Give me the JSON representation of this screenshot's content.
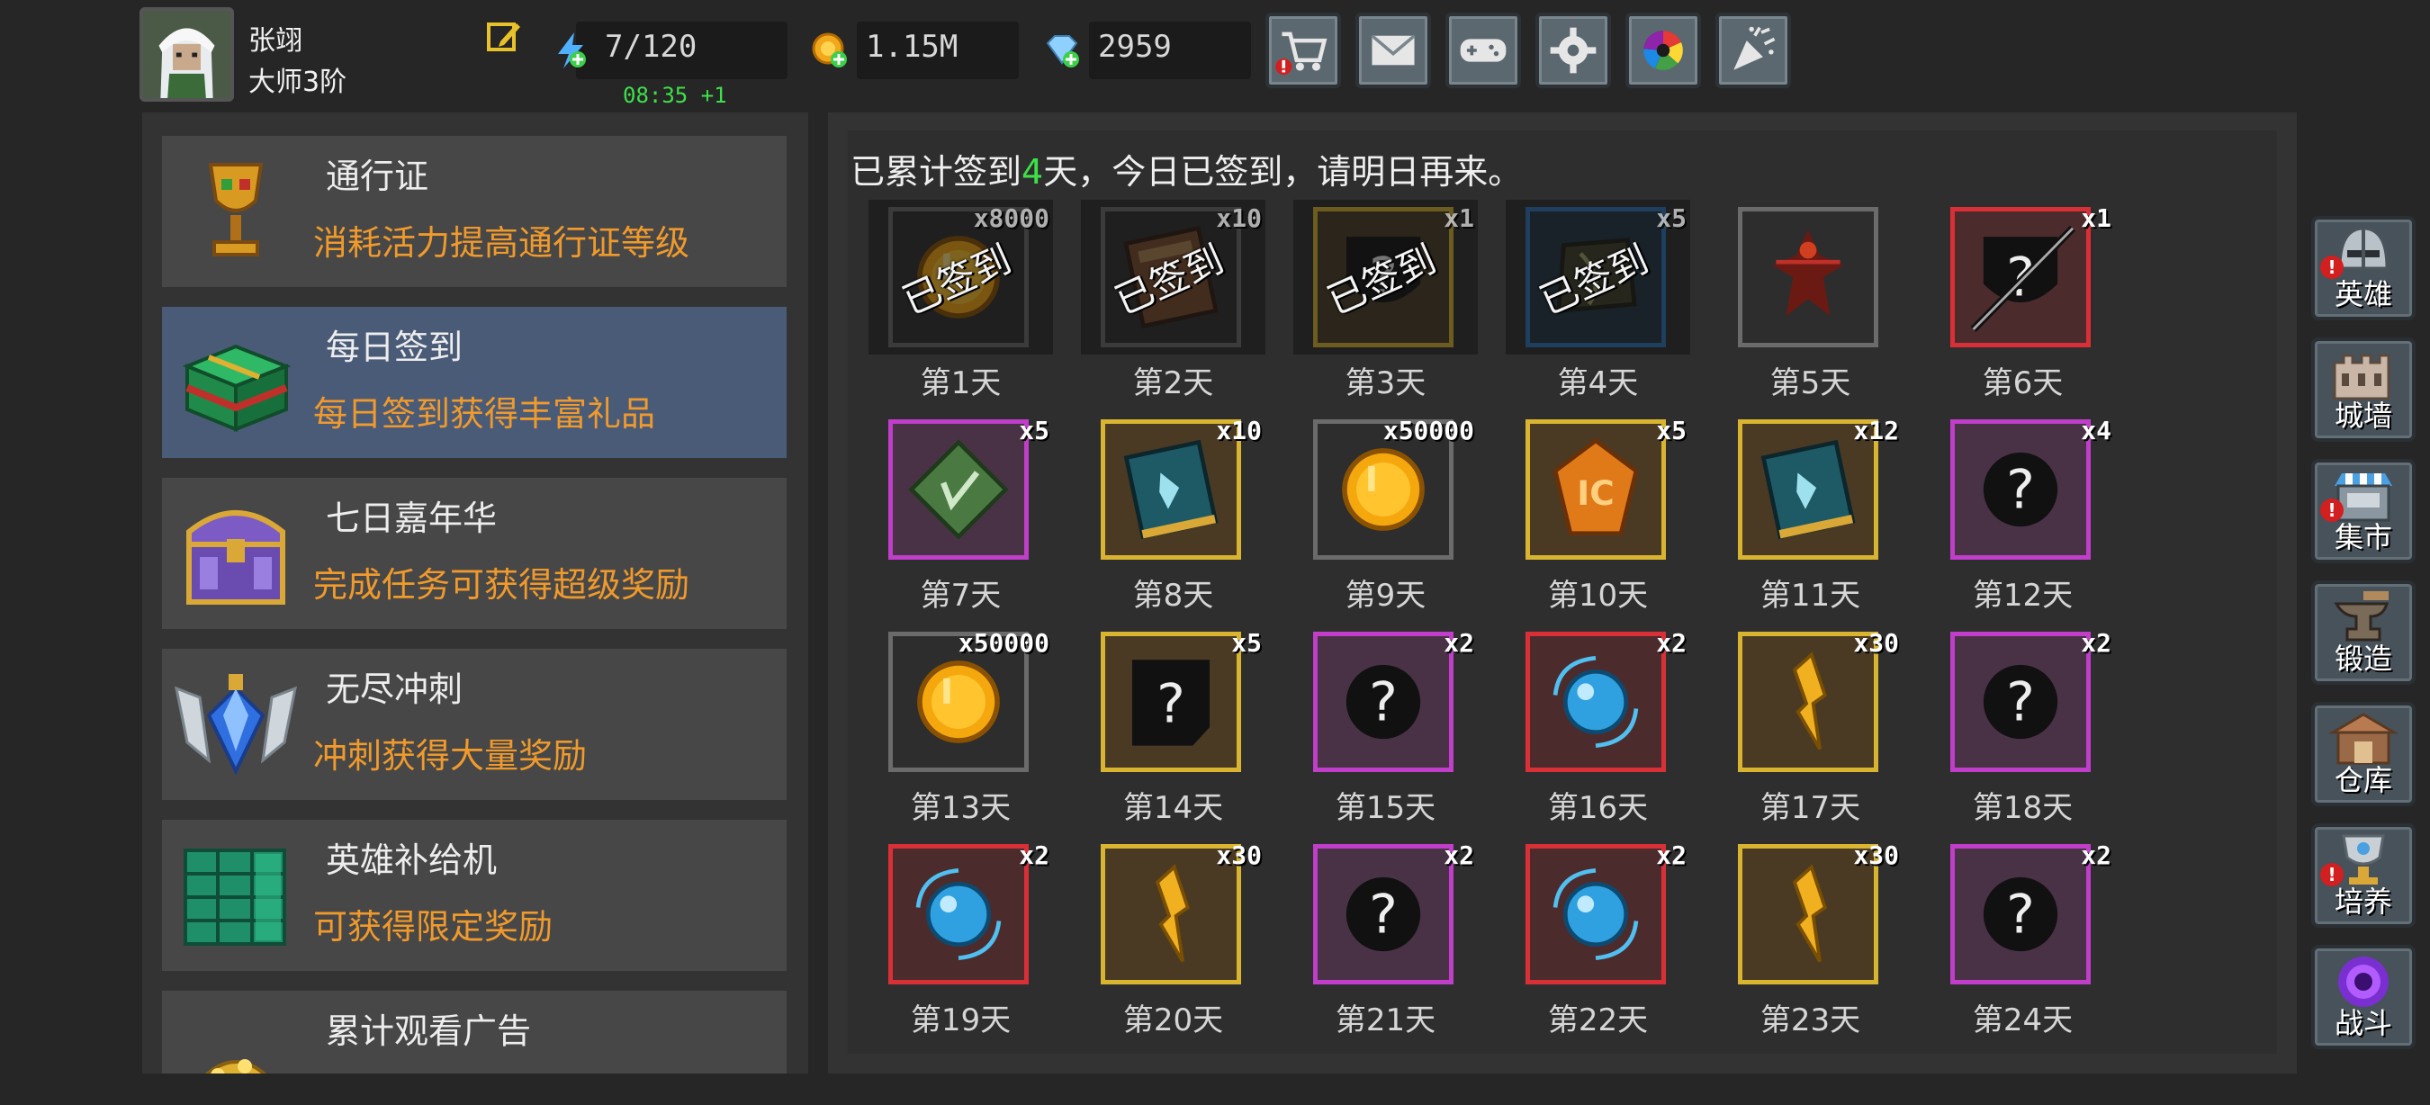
{
  "player": {
    "name": "张翊",
    "rank": "大师3阶"
  },
  "resources": {
    "energy": "7/120",
    "energy_timer": "08:35 +1",
    "gold": "1.15M",
    "gems": "2959"
  },
  "top_buttons": [
    {
      "name": "shop-button",
      "icon": "cart-icon",
      "alert": true
    },
    {
      "name": "mail-button",
      "icon": "envelope-icon",
      "alert": false
    },
    {
      "name": "gamepad-button",
      "icon": "gamepad-icon",
      "alert": false
    },
    {
      "name": "settings-button",
      "icon": "gear-icon",
      "alert": false
    },
    {
      "name": "aperture-button",
      "icon": "aperture-icon",
      "alert": false
    },
    {
      "name": "celebrate-button",
      "icon": "party-popper-icon",
      "alert": false
    }
  ],
  "activities": [
    {
      "title": "通行证",
      "desc": "消耗活力提高通行证等级",
      "icon": "chalice-icon",
      "selected": false
    },
    {
      "title": "每日签到",
      "desc": "每日签到获得丰富礼品",
      "icon": "gift-chest-icon",
      "selected": true
    },
    {
      "title": "七日嘉年华",
      "desc": "完成任务可获得超级奖励",
      "icon": "treasure-chest-icon",
      "selected": false
    },
    {
      "title": "无尽冲刺",
      "desc": "冲刺获得大量奖励",
      "icon": "winged-crystal-icon",
      "selected": false
    },
    {
      "title": "英雄补给机",
      "desc": "可获得限定奖励",
      "icon": "supply-machine-icon",
      "selected": false
    },
    {
      "title": "累计观看广告",
      "desc": "",
      "icon": "gold-pile-icon",
      "selected": false
    }
  ],
  "signin": {
    "status_prefix": "已累计签到",
    "days_count": "4",
    "status_suffix": "天，今日已签到，请明日再来。",
    "claimed_label": "已签到",
    "days": [
      {
        "label": "第1天",
        "qty": "x8000",
        "item": "gold-coin",
        "frame": "gray",
        "claimed": true
      },
      {
        "label": "第2天",
        "qty": "x10",
        "item": "brown-book",
        "frame": "gray",
        "claimed": true
      },
      {
        "label": "第3天",
        "qty": "x1",
        "item": "mystery-shield",
        "frame": "gold",
        "claimed": true
      },
      {
        "label": "第4天",
        "qty": "x5",
        "item": "dark-stone",
        "frame": "blue",
        "claimed": true
      },
      {
        "label": "第5天",
        "qty": "",
        "item": "hero-figure",
        "frame": "gray",
        "claimed": false
      },
      {
        "label": "第6天",
        "qty": "x1",
        "item": "mystery-shield-sword",
        "frame": "red",
        "claimed": false
      },
      {
        "label": "第7天",
        "qty": "x5",
        "item": "green-rune",
        "frame": "purple",
        "claimed": false
      },
      {
        "label": "第8天",
        "qty": "x10",
        "item": "teal-book",
        "frame": "gold",
        "claimed": false
      },
      {
        "label": "第9天",
        "qty": "x50000",
        "item": "gold-coin",
        "frame": "gray",
        "claimed": false
      },
      {
        "label": "第10天",
        "qty": "x5",
        "item": "amber-gem",
        "frame": "gold",
        "claimed": false
      },
      {
        "label": "第11天",
        "qty": "x12",
        "item": "teal-book",
        "frame": "gold",
        "claimed": false
      },
      {
        "label": "第12天",
        "qty": "x4",
        "item": "mystery-orb",
        "frame": "purple",
        "claimed": false
      },
      {
        "label": "第13天",
        "qty": "x50000",
        "item": "gold-coin",
        "frame": "gray",
        "claimed": false
      },
      {
        "label": "第14天",
        "qty": "x5",
        "item": "mystery-scroll",
        "frame": "gold",
        "claimed": false
      },
      {
        "label": "第15天",
        "qty": "x2",
        "item": "mystery-orb",
        "frame": "purple",
        "claimed": false
      },
      {
        "label": "第16天",
        "qty": "x2",
        "item": "blue-orb",
        "frame": "red",
        "claimed": false
      },
      {
        "label": "第17天",
        "qty": "x30",
        "item": "gold-shard",
        "frame": "gold",
        "claimed": false
      },
      {
        "label": "第18天",
        "qty": "x2",
        "item": "mystery-orb",
        "frame": "purple",
        "claimed": false
      },
      {
        "label": "第19天",
        "qty": "x2",
        "item": "blue-orb",
        "frame": "red",
        "claimed": false
      },
      {
        "label": "第20天",
        "qty": "x30",
        "item": "gold-shard",
        "frame": "gold",
        "claimed": false
      },
      {
        "label": "第21天",
        "qty": "x2",
        "item": "mystery-orb",
        "frame": "purple",
        "claimed": false
      },
      {
        "label": "第22天",
        "qty": "x2",
        "item": "blue-orb",
        "frame": "red",
        "claimed": false
      },
      {
        "label": "第23天",
        "qty": "x30",
        "item": "gold-shard",
        "frame": "gold",
        "claimed": false
      },
      {
        "label": "第24天",
        "qty": "x2",
        "item": "mystery-orb",
        "frame": "purple",
        "claimed": false
      }
    ]
  },
  "side_nav": [
    {
      "label": "英雄",
      "icon": "helmet-icon",
      "alert": true
    },
    {
      "label": "城墙",
      "icon": "castle-wall-icon",
      "alert": false
    },
    {
      "label": "集市",
      "icon": "market-stall-icon",
      "alert": true
    },
    {
      "label": "锻造",
      "icon": "anvil-icon",
      "alert": false
    },
    {
      "label": "仓库",
      "icon": "storehouse-icon",
      "alert": false
    },
    {
      "label": "培养",
      "icon": "trophy-cup-icon",
      "alert": true
    },
    {
      "label": "战斗",
      "icon": "portal-icon",
      "alert": false
    }
  ],
  "colors": {
    "background": "#262626",
    "panel": "#333333",
    "selected_item": "#4a5b78",
    "accent_orange": "#f09a2c",
    "accent_green": "#3ee04a",
    "alert_red": "#d21f1f"
  }
}
